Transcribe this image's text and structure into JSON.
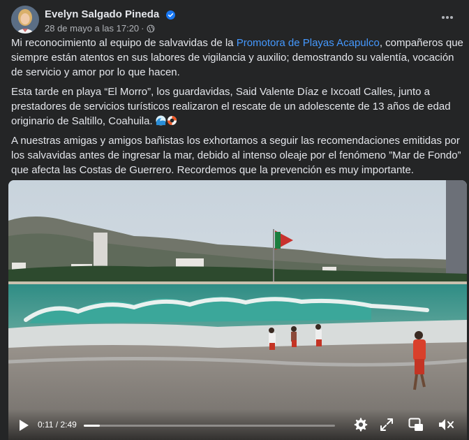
{
  "post": {
    "author": "Evelyn Salgado Pineda",
    "timestamp": "28 de mayo a las 17:20",
    "separator": "·",
    "verified_icon": "verified-badge-icon",
    "privacy_icon": "globe-icon",
    "more_icon": "more-horizontal-icon",
    "paragraphs": {
      "p1_before": "Mi reconocimiento al equipo de salvavidas de la ",
      "p1_link": "Promotora de Playas Acapulco",
      "p1_after": ", compañeros que siempre están atentos en sus labores de vigilancia y auxilio; demostrando su valentía, vocación de servicio y amor por lo que hacen.",
      "p2": "Esta tarde en playa “El  Morro”, los guardavidas, Said Valente Díaz e Ixcoatl Calles, junto a prestadores de servicios turísticos realizaron el rescate de un adolescente de 13 años de edad originario de Saltillo, Coahuila.",
      "p3": "A nuestras amigas y amigos bañistas los exhortamos a seguir las recomendaciones emitidas por los salvavidas antes de ingresar la mar, debido al intenso oleaje por el fenómeno ”Mar de Fondo” que afecta las Costas de Guerrero. Recordemos que la prevención es muy importante."
    },
    "emojis": [
      "wave-emoji",
      "life-buoy-emoji"
    ]
  },
  "video": {
    "current_time": "0:11",
    "duration": "2:49",
    "time_separator": " / ",
    "progress": 0.065,
    "controls": {
      "play": "play-icon",
      "settings": "gear-icon",
      "fullscreen": "expand-icon",
      "pip": "picture-in-picture-icon",
      "volume": "muted-speaker-icon"
    }
  },
  "colors": {
    "background": "#242526",
    "text": "#e4e6eb",
    "secondary_text": "#b0b3b8",
    "link": "#4599ff",
    "verified": "#1877f2"
  }
}
